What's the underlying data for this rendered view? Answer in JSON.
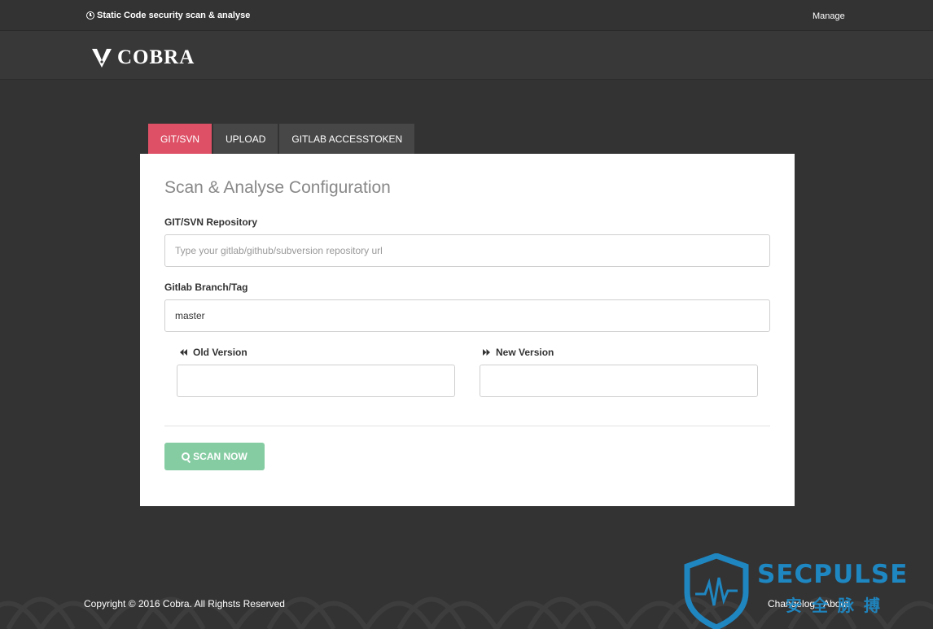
{
  "topbar": {
    "tagline": "Static Code security scan & analyse",
    "manage_label": "Manage"
  },
  "header": {
    "logo_text": "COBRA"
  },
  "tabs": [
    {
      "label": "GIT/SVN",
      "active": true
    },
    {
      "label": "UPLOAD",
      "active": false
    },
    {
      "label": "GITLAB ACCESSTOKEN",
      "active": false
    }
  ],
  "form": {
    "title": "Scan & Analyse Configuration",
    "repo_label": "GIT/SVN Repository",
    "repo_placeholder": "Type your gitlab/github/subversion repository url",
    "repo_value": "",
    "branch_label": "Gitlab Branch/Tag",
    "branch_value": "master",
    "old_version_label": "Old Version",
    "old_version_value": "",
    "new_version_label": "New Version",
    "new_version_value": "",
    "scan_label": "SCAN NOW"
  },
  "footer": {
    "copyright": "Copyright © 2016 Cobra. All Righsts Reserved",
    "changelog_label": "Changelog",
    "separator": "-",
    "about_label": "About"
  },
  "watermark": {
    "text": "SECPULSE",
    "sub": "安全脉搏"
  },
  "colors": {
    "active_tab": "#de5066",
    "scan_button": "#86cca3",
    "background": "#333333",
    "watermark": "#1d8fcf"
  }
}
